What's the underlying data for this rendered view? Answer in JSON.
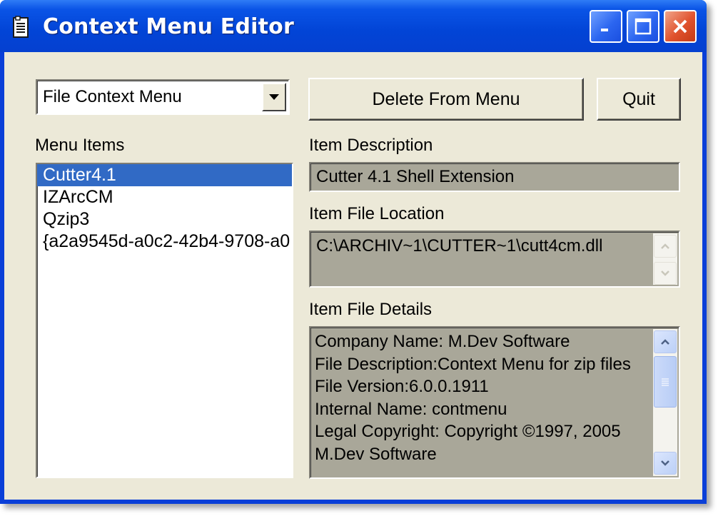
{
  "window": {
    "title": "Context Menu Editor",
    "minimize_icon": "minimize-icon",
    "maximize_icon": "maximize-icon",
    "close_icon": "close-icon",
    "title_icon": "application-icon"
  },
  "colors": {
    "titlebar": "#0a54e6",
    "client_bg": "#ece9d8",
    "selection": "#316ac5",
    "readonly_bg": "#a9a799",
    "close_button": "#e0522d"
  },
  "menu_type_select": {
    "value": "File Context Menu",
    "arrow_icon": "chevron-down-icon"
  },
  "buttons": {
    "delete_label": "Delete From Menu",
    "quit_label": "Quit"
  },
  "menu_items": {
    "label": "Menu Items",
    "items": [
      {
        "text": "Cutter4.1",
        "selected": true
      },
      {
        "text": "IZArcCM",
        "selected": false
      },
      {
        "text": "Qzip3",
        "selected": false
      },
      {
        "text": "{a2a9545d-a0c2-42b4-9708-a0",
        "selected": false
      }
    ]
  },
  "item_description": {
    "label": "Item Description",
    "value": "Cutter 4.1 Shell Extension"
  },
  "item_file_location": {
    "label": "Item File Location",
    "value": "C:\\ARCHIV~1\\CUTTER~1\\cutt4cm.dll"
  },
  "item_file_details": {
    "label": "Item File Details",
    "lines": [
      "Company Name: M.Dev Software",
      "File Description:Context Menu for zip files",
      "File Version:6.0.0.1911",
      "Internal Name: contmenu",
      "Legal Copyright: Copyright ©1997, 2005",
      "M.Dev Software"
    ]
  }
}
